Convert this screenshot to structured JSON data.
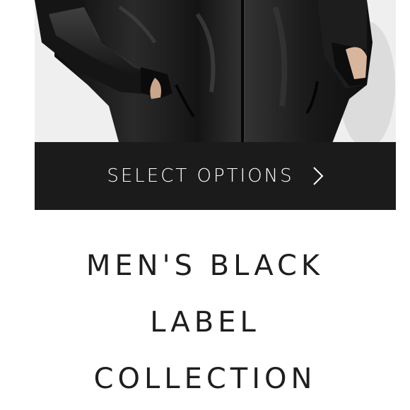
{
  "product": {
    "image_alt": "Men's black leather jacket"
  },
  "cta": {
    "label": "SELECT OPTIONS",
    "icon": "chevron-right-icon"
  },
  "collection": {
    "title_lines": [
      "MEN'S BLACK",
      "LABEL",
      "COLLECTION"
    ]
  },
  "colors": {
    "cta_background": "#1b1b1b",
    "cta_text": "#ffffff",
    "title_text": "#1e1e1e",
    "page_background": "#ffffff"
  }
}
